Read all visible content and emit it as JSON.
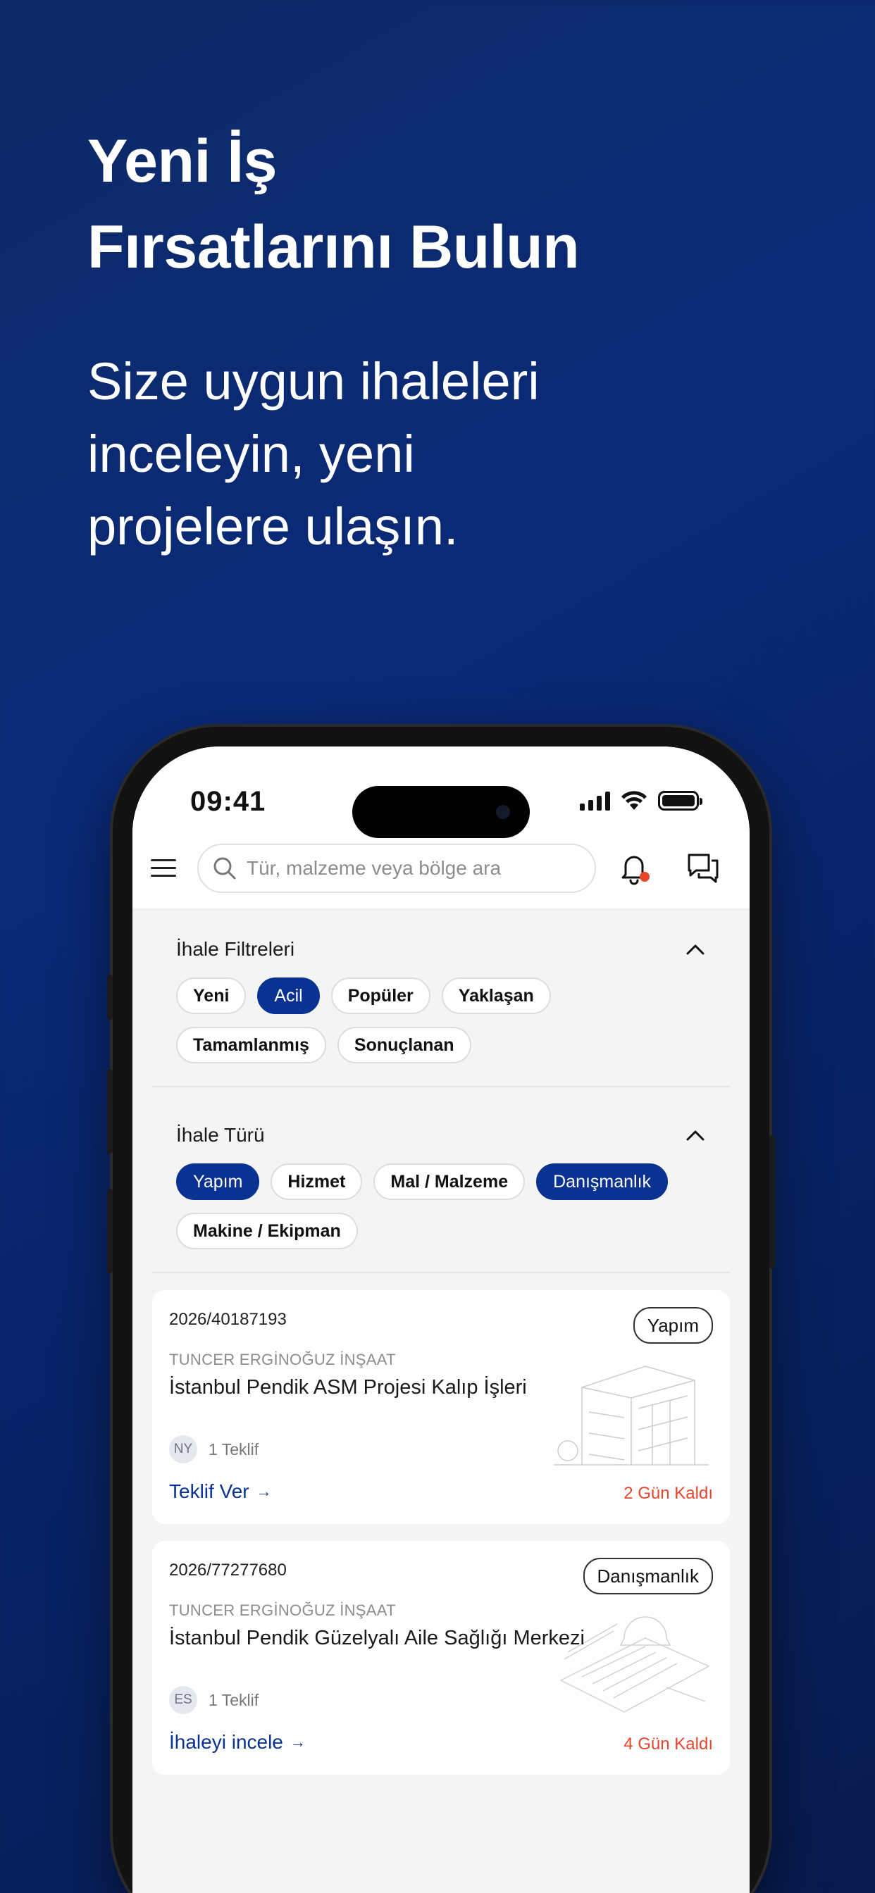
{
  "promo": {
    "headline_line1": "Yeni İş",
    "headline_line2": "Fırsatlarını Bulun",
    "subline_line1": "Size uygun ihaleleri",
    "subline_line2": "inceleyin, yeni",
    "subline_line3": "projelere ulaşın."
  },
  "status_bar": {
    "time": "09:41"
  },
  "search": {
    "placeholder": "Tür, malzeme veya bölge ara"
  },
  "filters": {
    "title": "İhale Filtreleri",
    "chips": [
      {
        "label": "Yeni",
        "active": false
      },
      {
        "label": "Acil",
        "active": true
      },
      {
        "label": "Popüler",
        "active": false
      },
      {
        "label": "Yaklaşan",
        "active": false
      },
      {
        "label": "Tamamlanmış",
        "active": false
      },
      {
        "label": "Sonuçlanan",
        "active": false
      }
    ]
  },
  "types": {
    "title": "İhale Türü",
    "chips": [
      {
        "label": "Yapım",
        "active": true
      },
      {
        "label": "Hizmet",
        "active": false
      },
      {
        "label": "Mal / Malzeme",
        "active": false
      },
      {
        "label": "Danışmanlık",
        "active": true
      },
      {
        "label": "Makine / Ekipman",
        "active": false
      }
    ]
  },
  "tenders": [
    {
      "code": "2026/40187193",
      "badge": "Yapım",
      "company": "TUNCER ERGİNOĞUZ İNŞAAT",
      "title": "İstanbul Pendik ASM Projesi Kalıp İşleri",
      "avatar": "NY",
      "bids": "1 Teklif",
      "cta": "Teklif Ver",
      "deadline": "2 Gün Kaldı"
    },
    {
      "code": "2026/77277680",
      "badge": "Danışmanlık",
      "company": "TUNCER ERGİNOĞUZ İNŞAAT",
      "title": "İstanbul Pendik Güzelyalı Aile Sağlığı Merkezi",
      "avatar": "ES",
      "bids": "1 Teklif",
      "cta": "İhaleyi incele",
      "deadline": "4 Gün Kaldı"
    }
  ],
  "colors": {
    "primary": "#0a3292",
    "deadline": "#e9442d",
    "background_top": "#0d2a66",
    "background_bottom": "#071a4d"
  }
}
